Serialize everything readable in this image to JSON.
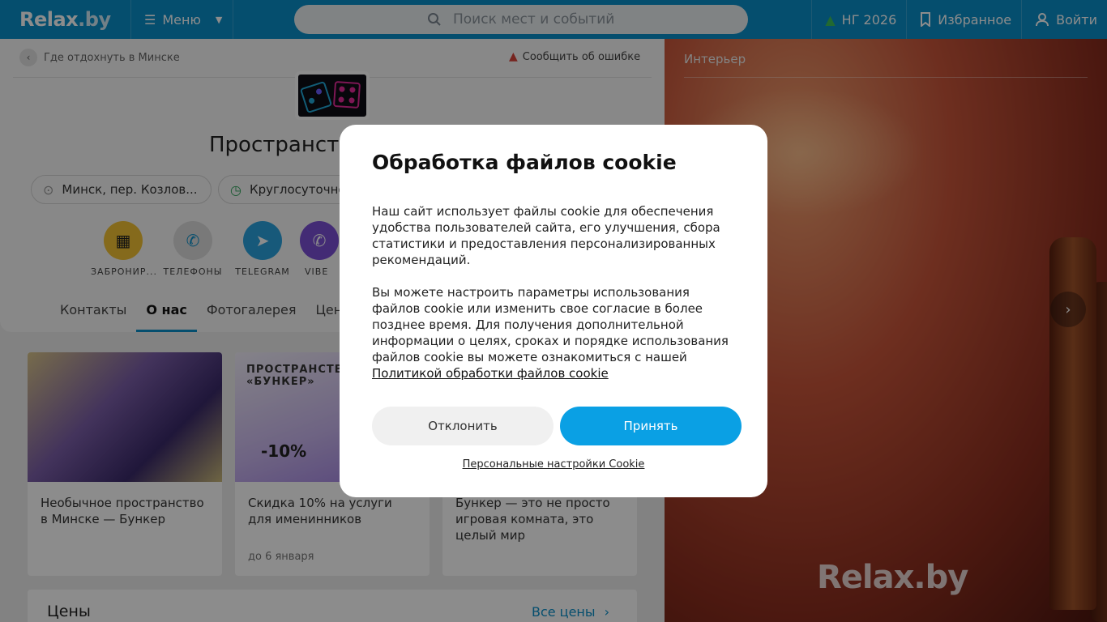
{
  "header": {
    "logo": "Relax",
    "logo_suffix": ".by",
    "menu_label": "Меню",
    "search_placeholder": "Поиск мест и событий",
    "ny_label": "НГ 2026",
    "favorites_label": "Избранное",
    "login_label": "Войти"
  },
  "page": {
    "breadcrumb": "Где отдохнуть в Минске",
    "report_error": "Сообщить об ошибке",
    "title": "Пространств",
    "address": "Минск, пер. Козлов...",
    "hours": "Круглосуточно",
    "actions": [
      {
        "label": "ЗАБРОНИР...",
        "color": "#f2c234"
      },
      {
        "label": "ТЕЛЕФОНЫ",
        "color": "#d6d6d6"
      },
      {
        "label": "TELEGRAM",
        "color": "#2aa3de"
      },
      {
        "label": "VIBE",
        "color": "#7b4fd6"
      }
    ],
    "tabs": [
      "Контакты",
      "О нас",
      "Фотогалерея",
      "Цены"
    ],
    "promos": [
      {
        "text": "Необычное пространство в Минске — Бункер",
        "sub": ""
      },
      {
        "badge": "ПРОСТРАНСТВО «БУНКЕР»",
        "discount": "-10%",
        "text": "Скидка 10% на услуги для именинников",
        "sub": "до 6 января"
      },
      {
        "text": "Бункер — это не просто игровая комната, это целый мир",
        "sub": ""
      }
    ],
    "prices_heading": "Цены",
    "all_prices": "Все цены"
  },
  "gallery": {
    "label": "Интерьер",
    "watermark": "Relax.by"
  },
  "cookie_modal": {
    "title": "Обработка файлов cookie",
    "paragraph1": "Наш сайт использует файлы cookie для обеспечения удобства пользователей сайта, его улучшения, сбора статистики и предоставления персонализированных рекомендаций.",
    "paragraph2": "Вы можете настроить параметры использования файлов cookie или изменить свое согласие в более позднее время. Для получения дополнительной информации о целях, сроках и порядке использования файлов cookie вы можете ознакомиться с нашей",
    "policy_link": "Политикой обработки файлов cookie",
    "decline": "Отклонить",
    "accept": "Принять",
    "personal_settings": "Персональные настройки Cookie"
  },
  "colors": {
    "brand": "#0a8fc9",
    "accept_button": "#0aa0e4"
  }
}
